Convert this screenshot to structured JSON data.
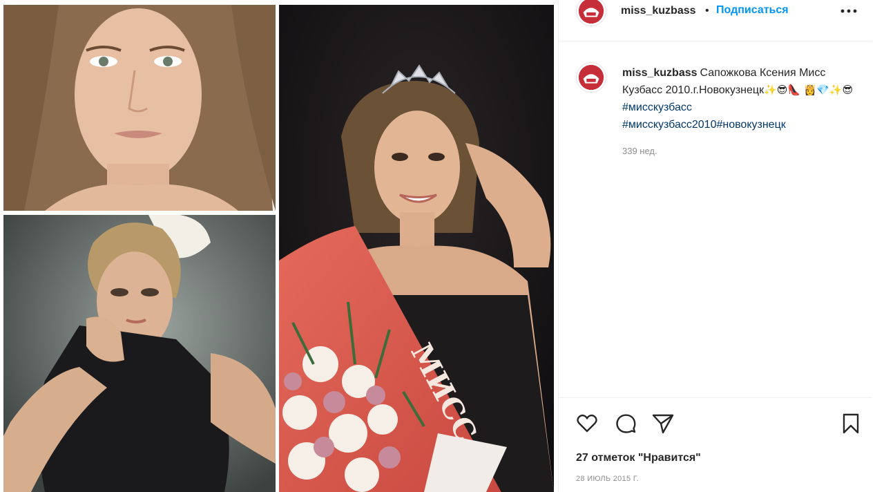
{
  "post": {
    "username": "miss_kuzbass",
    "separator": "•",
    "follow_label": "Подписаться",
    "more_icon": "more-horizontal-icon",
    "caption_text": "Сапожкова Ксения Мисс Кузбасс 2010.г.Новокузнецк",
    "caption_emoji_1": "✨😎👠",
    "caption_emoji_2": "👸💎✨😎",
    "hashtag_1": "#мисскузбасс",
    "hashtag_2": "#мисскузбасс2010",
    "hashtag_3": "#новокузнецк",
    "age": "339 нед.",
    "likes_text": "27 отметок \"Нравится\"",
    "date": "28 ИЮЛЬ 2015 Г.",
    "photo_sash_text": "МИСС",
    "colors": {
      "link_blue": "#0095f6",
      "hashtag": "#00376b",
      "secondary_text": "#8e8e8e",
      "avatar_red": "#c62f3a"
    },
    "icons": {
      "like": "heart-icon",
      "comment": "comment-icon",
      "share": "paper-plane-icon",
      "save": "bookmark-icon"
    }
  }
}
